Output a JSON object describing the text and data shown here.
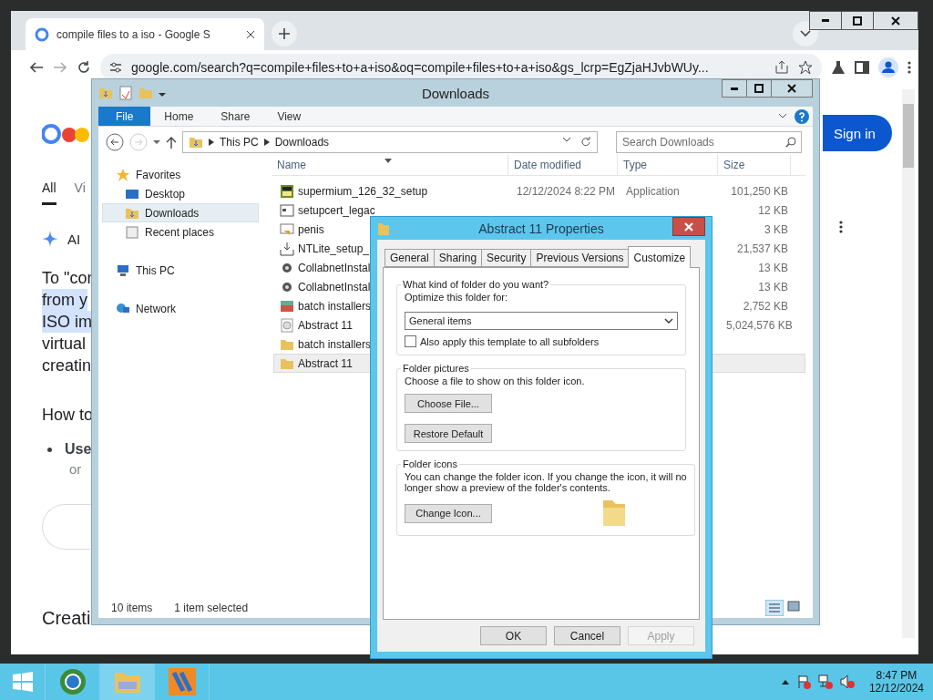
{
  "browser": {
    "tab_title": "compile files to a iso - Google S",
    "url": "google.com/search?q=compile+files+to+a+iso&oq=compile+files+to+a+iso&gs_lcrp=EgZjaHJvbWUy...",
    "sign_in": "Sign in",
    "search_tabs": [
      {
        "label": "All",
        "selected": true
      },
      {
        "label": "Vi",
        "selected": false
      }
    ],
    "ai_label": "AI",
    "lines": [
      {
        "text": "To \"cor",
        "highlighted": false
      },
      {
        "text": "from y",
        "highlighted": true
      },
      {
        "text": "ISO im",
        "highlighted": true
      },
      {
        "text": "virtual",
        "highlighted": false
      },
      {
        "text": "creatin",
        "highlighted": false
      }
    ],
    "heading": "How to",
    "bullet": "Use",
    "bullet_sub": "or",
    "footer_heading": "Creati"
  },
  "explorer": {
    "title": "Downloads",
    "ribbon": [
      {
        "label": "File",
        "kind": "file"
      },
      {
        "label": "Home",
        "kind": "tab"
      },
      {
        "label": "Share",
        "kind": "tab"
      },
      {
        "label": "View",
        "kind": "tab"
      }
    ],
    "path": [
      "This PC",
      "Downloads"
    ],
    "search": {
      "placeholder": "Search Downloads"
    },
    "nav": [
      {
        "label": "Favorites",
        "kind": "star",
        "selected": false,
        "children": [
          {
            "label": "Desktop",
            "kind": "desktop",
            "selected": false
          },
          {
            "label": "Downloads",
            "kind": "download",
            "selected": true
          },
          {
            "label": "Recent places",
            "kind": "recent",
            "selected": false
          }
        ]
      },
      {
        "label": "This PC",
        "kind": "pc",
        "selected": false
      },
      {
        "label": "Network",
        "kind": "network",
        "selected": false
      }
    ],
    "columns": [
      "Name",
      "Date modified",
      "Type",
      "Size"
    ],
    "rows": [
      {
        "name": "supermium_126_32_setup",
        "date": "12/12/2024 8:22 PM",
        "type": "Application",
        "size": "101,250 KB",
        "kind": "app",
        "selected": false
      },
      {
        "name": "setupcert_legac",
        "size": "12 KB",
        "kind": "window",
        "selected": false
      },
      {
        "name": "penis",
        "size": "3 KB",
        "kind": "shortcut",
        "selected": false
      },
      {
        "name": "NTLite_setup_",
        "size": "21,537 KB",
        "kind": "setup",
        "selected": false
      },
      {
        "name": "CollabnetInstal",
        "size": "13 KB",
        "kind": "gear",
        "selected": false
      },
      {
        "name": "CollabnetInstal",
        "size": "13 KB",
        "kind": "gear",
        "selected": false
      },
      {
        "name": "batch installers",
        "size": "2,752 KB",
        "kind": "archive",
        "selected": false
      },
      {
        "name": "Abstract 11",
        "size": "5,024,576 KB",
        "kind": "disc",
        "selected": false
      },
      {
        "name": "batch installers",
        "kind": "folder",
        "selected": false
      },
      {
        "name": "Abstract 11",
        "kind": "folder",
        "selected": true
      }
    ],
    "status": [
      "10 items",
      "1 item selected"
    ]
  },
  "dialog": {
    "title": "Abstract 11 Properties",
    "tabs": [
      {
        "label": "General",
        "selected": false
      },
      {
        "label": "Sharing",
        "selected": false
      },
      {
        "label": "Security",
        "selected": false
      },
      {
        "label": "Previous Versions",
        "selected": false
      },
      {
        "label": "Customize",
        "selected": true
      }
    ],
    "kind_group": {
      "title": "What kind of folder do you want?",
      "label": "Optimize this folder for:",
      "value": "General items",
      "checkbox": {
        "label": "Also apply this template to all subfolders",
        "checked": false
      }
    },
    "pictures_group": {
      "title": "Folder pictures",
      "text": "Choose a file to show on this folder icon.",
      "buttons": [
        "Choose File...",
        "Restore Default"
      ]
    },
    "icons_group": {
      "title": "Folder icons",
      "text": "You can change the folder icon. If you change the icon, it will no longer show a preview of the folder's contents.",
      "button": "Change Icon..."
    },
    "buttons": [
      {
        "label": "OK",
        "disabled": false
      },
      {
        "label": "Cancel",
        "disabled": false
      },
      {
        "label": "Apply",
        "disabled": true
      }
    ]
  },
  "taskbar": {
    "time": "8:47 PM",
    "date": "12/12/2024"
  }
}
